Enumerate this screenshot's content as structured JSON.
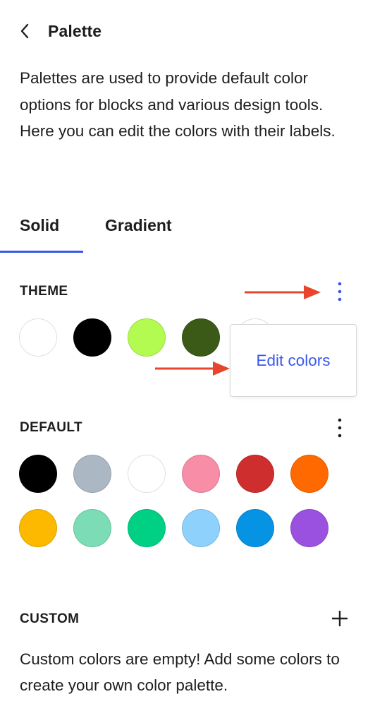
{
  "header": {
    "title": "Palette"
  },
  "description": "Palettes are used to provide default color options for blocks and various design tools. Here you can edit the colors with their labels.",
  "tabs": [
    {
      "label": "Solid",
      "selected": true
    },
    {
      "label": "Gradient",
      "selected": false
    }
  ],
  "accent_color": "#3858e9",
  "annotation_arrow_color": "#e8452c",
  "theme": {
    "label": "THEME",
    "colors": [
      "#ffffff",
      "#000000",
      "#b4fb51",
      "#3b5a17"
    ],
    "popover": {
      "item_label": "Edit colors"
    }
  },
  "default": {
    "label": "DEFAULT",
    "colors": [
      "#000000",
      "#abb8c3",
      "#ffffff",
      "#f78da7",
      "#cf2e2e",
      "#ff6900",
      "#fcb900",
      "#7bdcb5",
      "#00d084",
      "#8ed1fc",
      "#0693e3",
      "#9b51e0"
    ]
  },
  "custom": {
    "label": "CUSTOM",
    "empty_message": "Custom colors are empty! Add some colors to create your own color palette."
  },
  "icons": {
    "back": "chevron-left-icon",
    "more": "more-vertical-icon",
    "add": "plus-icon"
  }
}
